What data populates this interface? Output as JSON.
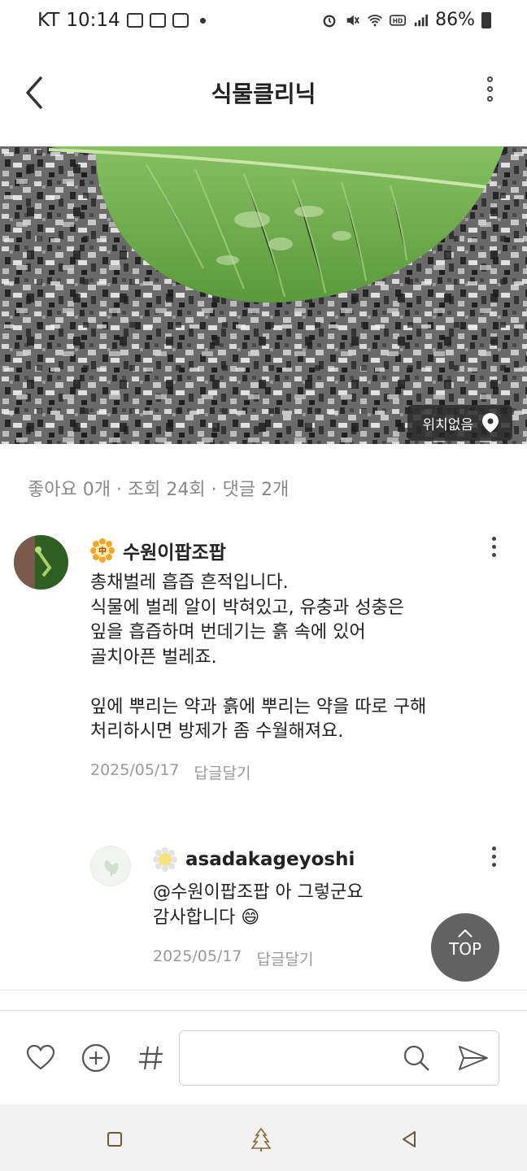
{
  "status_bar": {
    "carrier": "KT",
    "time": "10:14",
    "battery": "86%"
  },
  "header": {
    "title": "식물클리닉",
    "back_icon": "chevron-left-icon",
    "more_icon": "more-vertical-icon"
  },
  "photo": {
    "location_label": "위치없음",
    "location_icon": "location-pin-icon"
  },
  "stats": {
    "text": "좋아요 0개 · 조회 24회 · 댓글 2개"
  },
  "comments": [
    {
      "author": "수원이팝조팝",
      "badge_icon": "sunflower-badge-icon",
      "badge_glyph": "中",
      "text": "총채벌레 흡즙 흔적입니다.\n식물에 벌레 알이 박혀있고, 유충과 성충은\n잎을 흡즙하며 번데기는 흙 속에 있어\n골치아픈 벌레죠.\n\n잎에 뿌리는 약과 흙에 뿌리는 약을 따로 구해\n처리하시면 방제가 좀 수월해져요.",
      "date": "2025/05/17",
      "reply_label": "답글달기"
    },
    {
      "author": "asadakageyoshi",
      "badge_icon": "flower-badge-icon",
      "text": "@수원이팝조팝 아 그렇군요\n감사합니다 😄",
      "date": "2025/05/17",
      "reply_label": "답글달기"
    }
  ],
  "top_button": {
    "label": "TOP"
  },
  "bottom_bar": {
    "input_placeholder": "",
    "icons": [
      "heart-icon",
      "plus-circle-icon",
      "hashtag-icon",
      "search-icon",
      "send-icon"
    ]
  },
  "nav_bar": {
    "icons": [
      "recents-icon",
      "home-tree-icon",
      "back-triangle-icon"
    ]
  },
  "colors": {
    "leaf": "#6fae4b",
    "granite": "#6b6b6b",
    "top_button": "#626262",
    "meta_text": "#999999"
  }
}
